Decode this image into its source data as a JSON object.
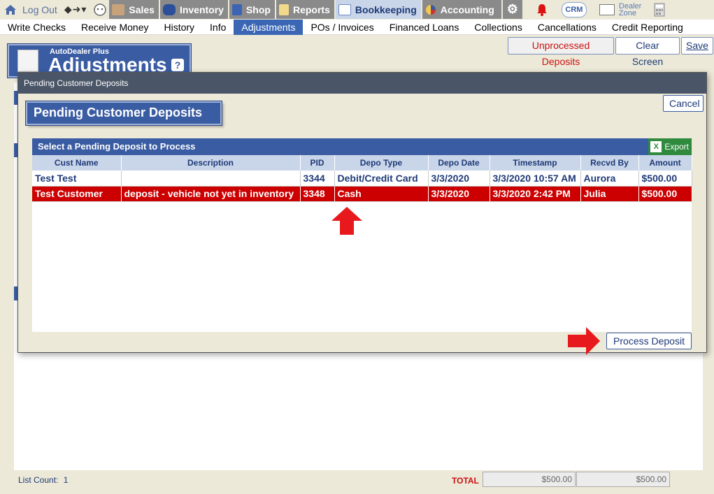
{
  "topnav": {
    "logout": "Log Out",
    "items": [
      {
        "label": "Sales",
        "icon": "salesperson-icon"
      },
      {
        "label": "Inventory",
        "icon": "car-icon"
      },
      {
        "label": "Shop",
        "icon": "wrench-icon"
      },
      {
        "label": "Reports",
        "icon": "report-icon"
      },
      {
        "label": "Bookkeeping",
        "icon": "book-icon"
      },
      {
        "label": "Accounting",
        "icon": "pie-chart-icon"
      }
    ],
    "crm": "CRM",
    "dealer_zone": "Dealer Zone"
  },
  "subnav": [
    "Write Checks",
    "Receive Money",
    "History",
    "Info",
    "Adjustments",
    "POs / Invoices",
    "Financed Loans",
    "Collections",
    "Cancellations",
    "Credit Reporting"
  ],
  "subnav_active": "Adjustments",
  "actions": {
    "unprocessed": "Unprocessed Deposits",
    "clear": "Clear Screen",
    "save": "Save"
  },
  "page": {
    "app_name": "AutoDealer Plus",
    "title": "Adjustments",
    "help": "?"
  },
  "modal": {
    "bar_title": "Pending Customer Deposits",
    "heading": "Pending Customer Deposits",
    "cancel": "Cancel",
    "list_title": "Select a Pending Deposit to Process",
    "export": "Export",
    "process": "Process Deposit",
    "columns": [
      "Cust Name",
      "Description",
      "PID",
      "Depo Type",
      "Depo Date",
      "Timestamp",
      "Recvd By",
      "Amount"
    ],
    "rows": [
      [
        "Test Test",
        "",
        "3344",
        "Debit/Credit Card",
        "3/3/2020",
        "3/3/2020 10:57 AM",
        "Aurora",
        "$500.00"
      ],
      [
        "Test Customer",
        "deposit - vehicle not yet in inventory",
        "3348",
        "Cash",
        "3/3/2020",
        "3/3/2020 2:42 PM",
        "Julia",
        "$500.00"
      ]
    ]
  },
  "footer": {
    "list_count_label": "List Count:",
    "list_count": "1",
    "total_label": "TOTAL",
    "total_1": "$500.00",
    "total_2": "$500.00"
  },
  "colors": {
    "accent": "#3a5ca3",
    "selected_row": "#cc0000",
    "export": "#2f8a3e",
    "annotation_arrow": "#e8191d"
  }
}
